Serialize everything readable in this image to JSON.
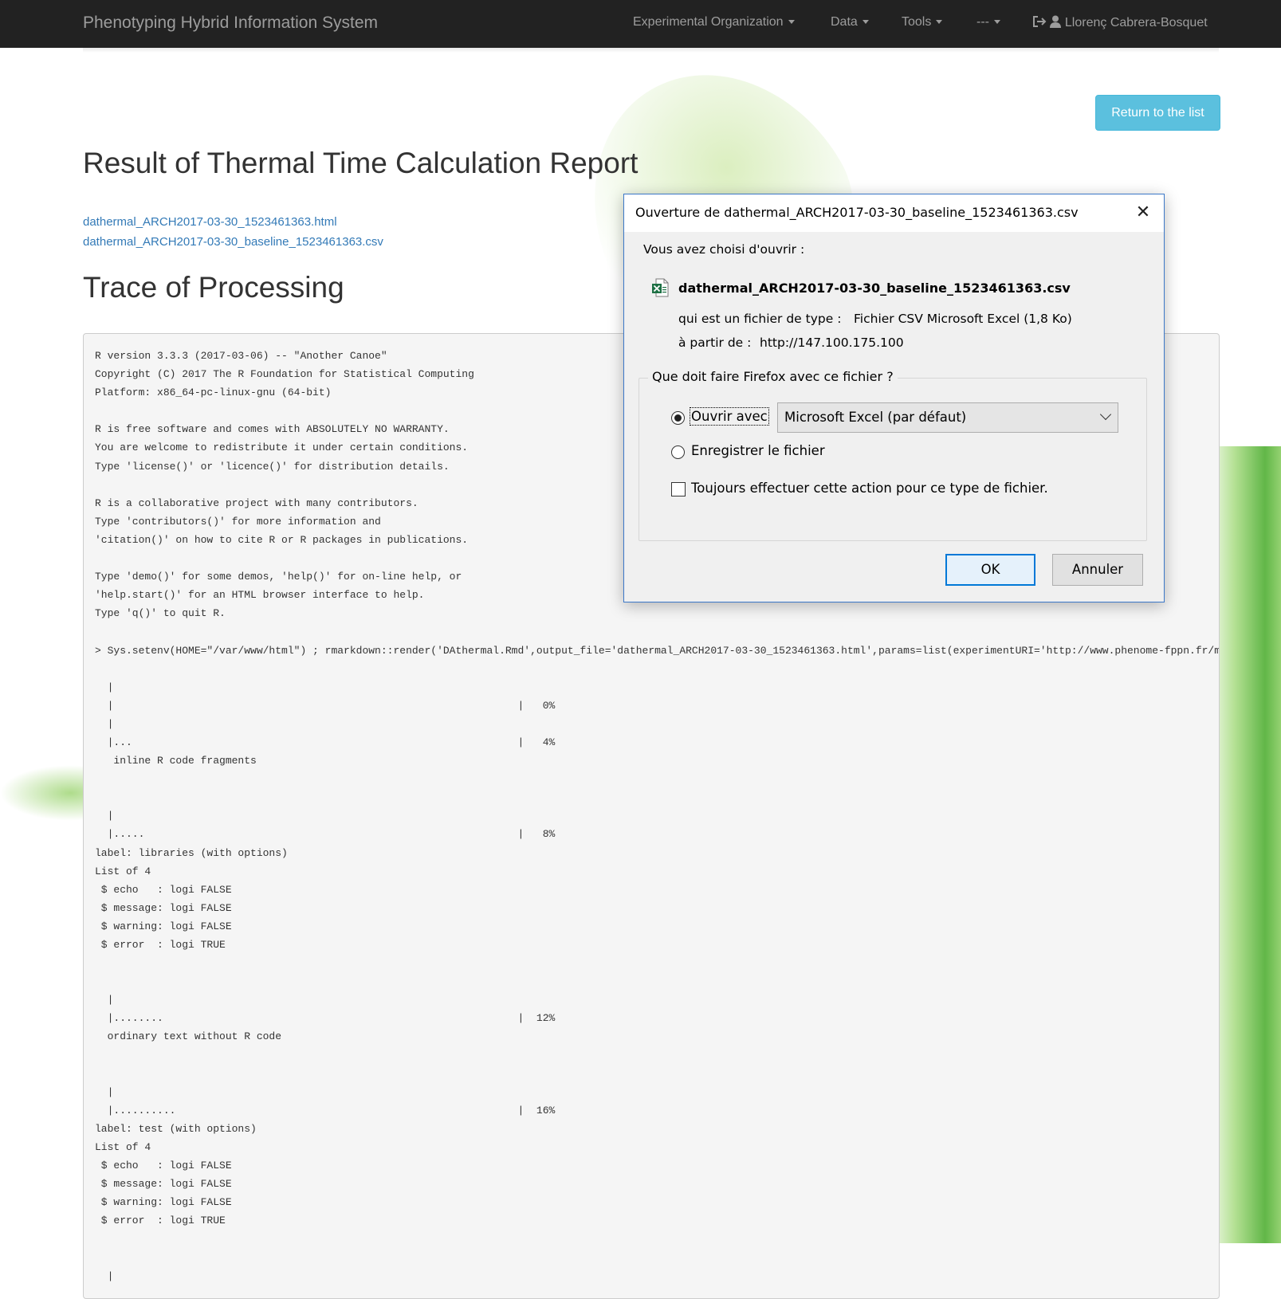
{
  "navbar": {
    "brand": "Phenotyping Hybrid Information System",
    "items": [
      {
        "label": "Experimental Organization"
      },
      {
        "label": "Data"
      },
      {
        "label": "Tools"
      },
      {
        "label": "---"
      }
    ],
    "user": "Llorenç Cabrera-Bosquet"
  },
  "page": {
    "return_button": "Return to the list",
    "title": "Result of Thermal Time Calculation Report",
    "links": [
      "dathermal_ARCH2017-03-30_1523461363.html",
      "dathermal_ARCH2017-03-30_baseline_1523461363.csv"
    ],
    "trace_title": "Trace of Processing",
    "trace_text": "R version 3.3.3 (2017-03-06) -- \"Another Canoe\"\nCopyright (C) 2017 The R Foundation for Statistical Computing\nPlatform: x86_64-pc-linux-gnu (64-bit)\n\nR is free software and comes with ABSOLUTELY NO WARRANTY.\nYou are welcome to redistribute it under certain conditions.\nType 'license()' or 'licence()' for distribution details.\n\nR is a collaborative project with many contributors.\nType 'contributors()' for more information and\n'citation()' on how to cite R or R packages in publications.\n\nType 'demo()' for some demos, 'help()' for on-line help, or\n'help.start()' for an HTML browser interface to help.\nType 'q()' to quit R.\n\n> Sys.setenv(HOME=\"/var/www/html\") ; rmarkdown::render('DAthermal.Rmd',output_file='dathermal_ARCH2017-03-30_1523461363.html',params=list(experimentURI='http://www.phenome-fppn.fr/m\n\n  |\n  |                                                                 |   0%\n  |\n  |...                                                              |   4%\n   inline R code fragments\n\n\n  |\n  |.....                                                            |   8%\nlabel: libraries (with options)\nList of 4\n $ echo   : logi FALSE\n $ message: logi FALSE\n $ warning: logi FALSE\n $ error  : logi TRUE\n\n\n  |\n  |........                                                         |  12%\n  ordinary text without R code\n\n\n  |\n  |..........                                                       |  16%\nlabel: test (with options)\nList of 4\n $ echo   : logi FALSE\n $ message: logi FALSE\n $ warning: logi FALSE\n $ error  : logi TRUE\n\n\n  |"
  },
  "dialog": {
    "title": "Ouverture de dathermal_ARCH2017-03-30_baseline_1523461363.csv",
    "intro": "Vous avez choisi d'ouvrir :",
    "filename": "dathermal_ARCH2017-03-30_baseline_1523461363.csv",
    "type_label": "qui est un fichier de type :",
    "type_value": "Fichier CSV Microsoft Excel (1,8 Ko)",
    "from_label": "à partir de :",
    "from_value": "http://147.100.175.100",
    "group_label": "Que doit faire Firefox avec ce fichier ?",
    "open_with_label": "Ouvrir avec",
    "open_with_value": "Microsoft Excel (par défaut)",
    "save_label": "Enregistrer le fichier",
    "always_label": "Toujours effectuer cette action pour ce type de fichier.",
    "ok_label": "OK",
    "cancel_label": "Annuler",
    "close_glyph": "✕"
  },
  "colors": {
    "navbar": "#222222",
    "link": "#337ab7",
    "info_button": "#5bc0de",
    "dialog_border": "#3c78c8",
    "ok_border": "#0078d7"
  },
  "icons": [
    "caret-down-icon",
    "logout-icon",
    "user-icon",
    "close-icon",
    "excel-file-icon",
    "chevron-down-icon"
  ]
}
